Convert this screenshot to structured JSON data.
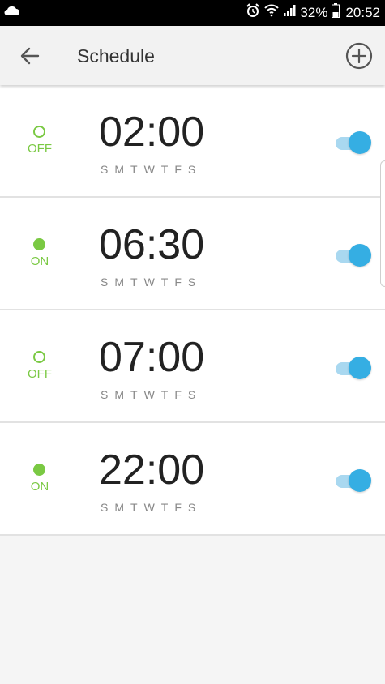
{
  "status_bar": {
    "battery_percent": "32%",
    "time": "20:52",
    "icons": [
      "cloud-icon",
      "alarm-icon",
      "wifi-icon",
      "signal-icon",
      "battery-icon"
    ]
  },
  "app_bar": {
    "title": "Schedule",
    "back_icon": "arrow-left-icon",
    "add_icon": "add-circle-icon"
  },
  "colors": {
    "accent_green": "#7ac943",
    "toggle_blue": "#35aee3"
  },
  "schedules": [
    {
      "state": "OFF",
      "time": "02:00",
      "days": [
        "S",
        "M",
        "T",
        "W",
        "T",
        "F",
        "S"
      ],
      "enabled": true
    },
    {
      "state": "ON",
      "time": "06:30",
      "days": [
        "S",
        "M",
        "T",
        "W",
        "T",
        "F",
        "S"
      ],
      "enabled": true
    },
    {
      "state": "OFF",
      "time": "07:00",
      "days": [
        "S",
        "M",
        "T",
        "W",
        "T",
        "F",
        "S"
      ],
      "enabled": true
    },
    {
      "state": "ON",
      "time": "22:00",
      "days": [
        "S",
        "M",
        "T",
        "W",
        "T",
        "F",
        "S"
      ],
      "enabled": true
    }
  ]
}
